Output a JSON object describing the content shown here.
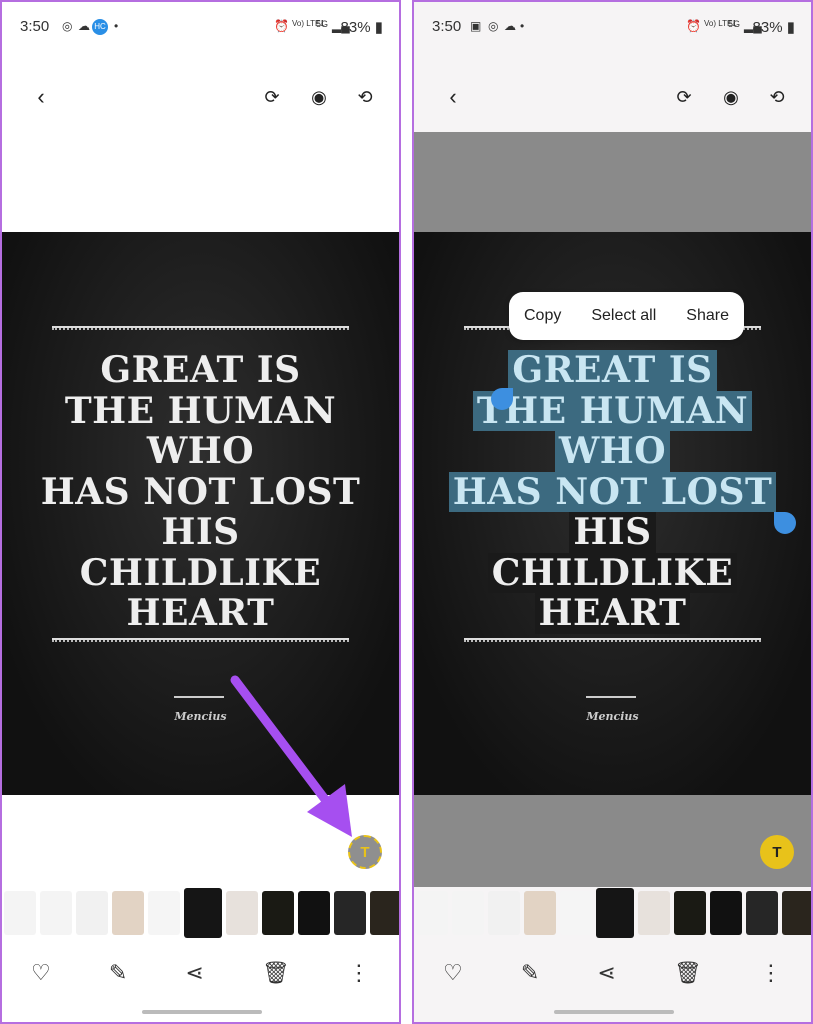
{
  "status": {
    "time": "3:50",
    "battery": "83%",
    "network": "5G",
    "carrier": "Vo) LTE1"
  },
  "photo": {
    "quote_lines": [
      "GREAT IS",
      "THE HUMAN",
      "WHO",
      "HAS NOT LOST",
      "HIS",
      "CHILDLIKE",
      "HEART"
    ],
    "signature": "Mencius"
  },
  "context_menu": {
    "copy": "Copy",
    "select_all": "Select all",
    "share": "Share"
  },
  "text_button_icon": "T",
  "colors": {
    "accent": "#3d8fe0",
    "highlight": "#3c6a80",
    "arrow": "#a64ff0",
    "text_icon": "#e8c21a"
  },
  "thumbnails": [
    "#f4f4f4",
    "#f4f4f4",
    "#f1f1f1",
    "#e2d3c4",
    "#f5f5f5",
    "#151515",
    "#e7e1dc",
    "#1a1a14",
    "#111111",
    "#262626",
    "#2a251d"
  ],
  "selected_thumbnail": 5
}
